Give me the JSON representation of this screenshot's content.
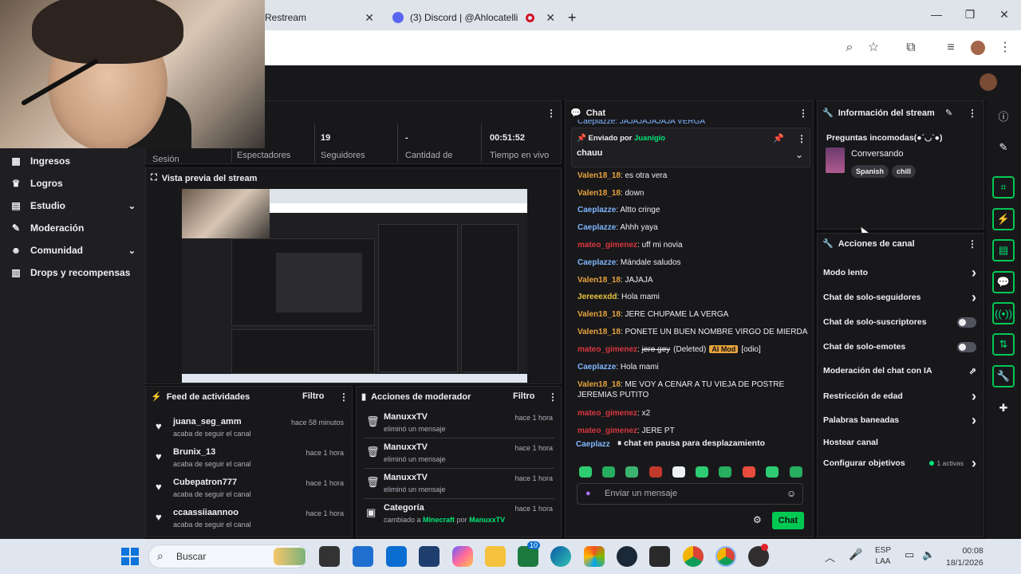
{
  "browser": {
    "tabs": [
      {
        "label": "Restream"
      },
      {
        "label": "(3) Discord | @Ahlocatelli"
      }
    ],
    "new_tab": "+"
  },
  "nav": {
    "items": [
      {
        "label": "Ingresos",
        "icon": "bank-icon"
      },
      {
        "label": "Logros",
        "icon": "trophy-icon"
      },
      {
        "label": "Estudio",
        "icon": "studio-icon"
      },
      {
        "label": "Moderación",
        "icon": "wrench-icon"
      },
      {
        "label": "Comunidad",
        "icon": "people-icon"
      },
      {
        "label": "Drops y recompensas",
        "icon": "gift-icon"
      }
    ]
  },
  "stats": {
    "session_label": "Sesión",
    "viewers_label": "Espectadores",
    "followers_value": "19",
    "followers_label": "Seguidores",
    "amount_value": "-",
    "amount_label": "Cantidad de",
    "live_value": "00:51:52",
    "live_label": "Tiempo en vivo"
  },
  "preview": {
    "title": "Vista previa del stream"
  },
  "activity": {
    "title": "Feed de actividades",
    "filter": "Filtro",
    "rows": [
      {
        "name": "juana_seg_amm",
        "sub": "acaba de seguir el canal",
        "time": "hace 58 minutos"
      },
      {
        "name": "Brunix_13",
        "sub": "acaba de seguir el canal",
        "time": "hace 1 hora"
      },
      {
        "name": "Cubepatron777",
        "sub": "acaba de seguir el canal",
        "time": "hace 1 hora"
      },
      {
        "name": "ccaassiiaannoo",
        "sub": "acaba de seguir el canal",
        "time": "hace 1 hora"
      }
    ]
  },
  "modactions": {
    "title": "Acciones de moderador",
    "filter": "Filtro",
    "rows": [
      {
        "name": "ManuxxTV",
        "sub": "eliminó un mensaje",
        "time": "hace 1 hora"
      },
      {
        "name": "ManuxxTV",
        "sub": "eliminó un mensaje",
        "time": "hace 1 hora"
      },
      {
        "name": "ManuxxTV",
        "sub": "eliminó un mensaje",
        "time": "hace 1 hora"
      },
      {
        "name": "Categoría",
        "sub_prefix": "cambiado a",
        "sub_game": "Minecraft",
        "sub_by": "por",
        "sub_user": "ManuxxTV",
        "time": "hace 1 hora"
      }
    ]
  },
  "chat": {
    "title": "Chat",
    "top_cut": "Caeplazze: JAJAJAJAJAJA VERGA",
    "pinned_by_prefix": "Enviado por",
    "pinned_by_user": "Juanigio",
    "pinned_text": "chauu",
    "messages": [
      {
        "user": "Valen18_18",
        "text": "es otra vera",
        "color": "#e8a33d"
      },
      {
        "user": "Valen18_18",
        "text": "down",
        "color": "#e8a33d"
      },
      {
        "user": "Caeplazze",
        "text": "Altto cringe",
        "color": "#7fb6ff"
      },
      {
        "user": "Caeplazze",
        "text": "Ahhh yaya",
        "color": "#7fb6ff"
      },
      {
        "user": "mateo_gimenez",
        "text": "uff mi novia",
        "color": "#d9363e"
      },
      {
        "user": "Caeplazze",
        "text": "Mándale saludos",
        "color": "#7fb6ff"
      },
      {
        "user": "Valen18_18",
        "text": "JAJAJA",
        "color": "#e8a33d"
      },
      {
        "user": "Jereeexdd",
        "text": "Hola mami",
        "color": "#e8c33d"
      },
      {
        "user": "Valen18_18",
        "text": "JERE CHUPAME LA VERGA",
        "color": "#e8a33d"
      },
      {
        "user": "Valen18_18",
        "text": "PONETE UN BUEN NOMBRE VIRGO DE MIERDA",
        "color": "#e8a33d"
      },
      {
        "user": "mateo_gimenez",
        "text": "jere gey",
        "color": "#d9363e",
        "deleted": "(Deleted)",
        "ai_mod": "AI Mod",
        "tag": "[odio]"
      },
      {
        "user": "Caeplazze",
        "text": "Hola mami",
        "color": "#7fb6ff"
      },
      {
        "user": "Valen18_18",
        "text": "ME VOY A CENAR A TU VIEJA DE POSTRE JEREMIAS PUTITO",
        "color": "#e8a33d"
      },
      {
        "user": "mateo_gimenez",
        "text": "x2",
        "color": "#d9363e"
      },
      {
        "user": "mateo_gimenez",
        "text": "JERE PT",
        "color": "#d9363e"
      }
    ],
    "partial_user": "Caeplazz",
    "paused": "chat en pausa para desplazamiento",
    "input_placeholder": "Enviar un mensaje",
    "send": "Chat"
  },
  "streaminfo": {
    "title": "Información del stream",
    "stream_title": "Preguntas incomodas(●´◡`●)",
    "category": "Conversando",
    "tags": [
      "Spanish",
      "chill"
    ]
  },
  "channel_actions": {
    "title": "Acciones de canal",
    "items": [
      {
        "label": "Modo lento",
        "kind": "chevron"
      },
      {
        "label": "Chat de solo-seguidores",
        "kind": "chevron"
      },
      {
        "label": "Chat de solo-suscriptores",
        "kind": "toggle"
      },
      {
        "label": "Chat de solo-emotes",
        "kind": "toggle"
      },
      {
        "label": "Moderación del chat con IA",
        "kind": "external"
      },
      {
        "label": "Restricción de edad",
        "kind": "chevron"
      },
      {
        "label": "Palabras baneadas",
        "kind": "chevron"
      },
      {
        "label": "Hostear canal",
        "kind": "none"
      },
      {
        "label": "Configurar objetivos",
        "kind": "chevron",
        "extra": "1 activas"
      }
    ]
  },
  "taskbar": {
    "search": "Buscar",
    "lang1": "ESP",
    "lang2": "LAA",
    "time": "00:08",
    "date": "18/1/2026",
    "edge_badge": "10"
  },
  "colors": {
    "accent_green": "#00e676",
    "twitch_dark": "#18181b"
  }
}
